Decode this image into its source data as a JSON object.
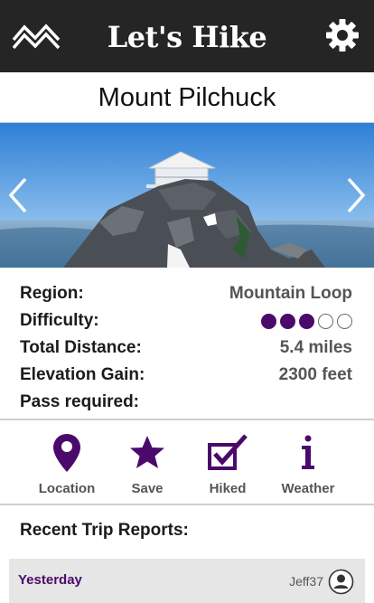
{
  "header": {
    "app_title": "Let's Hike",
    "logo_icon": "mountains-icon",
    "settings_icon": "gear-icon"
  },
  "trail": {
    "name": "Mount Pilchuck"
  },
  "carousel": {
    "prev_icon": "chevron-left-icon",
    "next_icon": "chevron-right-icon"
  },
  "details": {
    "region_label": "Region:",
    "region_value": "Mountain Loop",
    "difficulty_label": "Difficulty:",
    "difficulty_level": 3,
    "difficulty_max": 5,
    "distance_label": "Total Distance:",
    "distance_value": "5.4 miles",
    "elevation_label": "Elevation Gain:",
    "elevation_value": "2300 feet",
    "pass_label": "Pass required:",
    "pass_value": ""
  },
  "actions": [
    {
      "label": "Location",
      "icon": "location-pin-icon"
    },
    {
      "label": "Save",
      "icon": "star-icon"
    },
    {
      "label": "Hiked",
      "icon": "checkbox-icon"
    },
    {
      "label": "Weather",
      "icon": "info-icon"
    }
  ],
  "reports": {
    "heading": "Recent Trip Reports:",
    "items": [
      {
        "when": "Yesterday",
        "author": "Jeff37",
        "icon": "user-avatar-icon"
      }
    ]
  },
  "colors": {
    "header_bg": "#252525",
    "accent": "#4b0a6b",
    "muted_text": "#555555",
    "report_bg": "#e6e6e6"
  }
}
